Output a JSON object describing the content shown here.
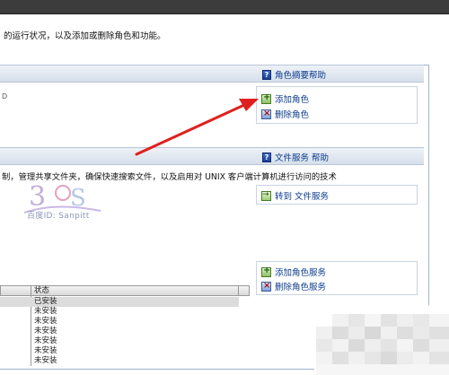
{
  "header": {
    "description": "的运行状况，以及添加或删除角色和功能。"
  },
  "roles_section": {
    "help_label": "角色摘要帮助",
    "add_role": "添加角色",
    "remove_role": "删除角色",
    "stub_text": "D"
  },
  "file_services_section": {
    "help_label": "文件服务  帮助",
    "description": "制，管理共享文件夹，确保快速搜索文件，以及启用对 UNIX 客户端计算机进行访问的技术",
    "goto_label": "转到 文件服务",
    "add_role_service": "添加角色服务",
    "remove_role_service": "删除角色服务"
  },
  "role_services_table": {
    "column_header": "状态",
    "rows": [
      "已安装",
      "未安装",
      "未安装",
      "未安装",
      "未安装",
      "未安装",
      "未安装"
    ]
  },
  "watermark": {
    "text": "百度ID: Sanpitt"
  },
  "colors": {
    "link": "#0b3c8c",
    "arrow": "#e0201e"
  }
}
